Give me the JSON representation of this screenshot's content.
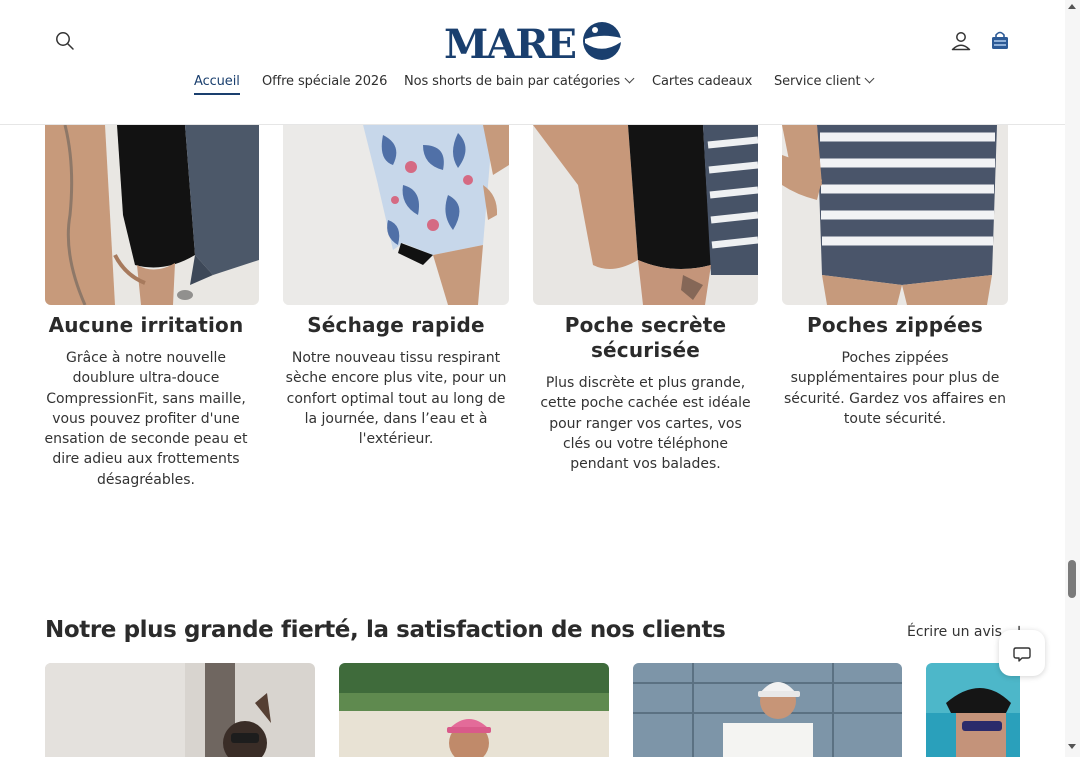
{
  "brand": {
    "logo_text": "MARE",
    "primary_color": "#1a3f6e",
    "accent_color": "#2c5a96"
  },
  "header": {
    "search_icon": "search-icon",
    "account_icon": "account-icon",
    "cart_icon": "shopping-bag-icon",
    "nav": [
      {
        "label": "Accueil",
        "active": true
      },
      {
        "label": "Offre spéciale 2026"
      },
      {
        "label": "Nos shorts de bain par catégories",
        "has_dropdown": true
      },
      {
        "label": "Cartes cadeaux"
      },
      {
        "label": "Service client",
        "has_dropdown": true
      }
    ]
  },
  "features": [
    {
      "title": "Aucune irritation",
      "lines": [
        "Grâce à notre nouvelle",
        "doublure ultra-douce",
        "CompressionFit, sans maille,",
        "vous pouvez profiter d'une",
        "ensation de seconde peau et",
        "dire adieu aux frottements",
        "désagréables."
      ]
    },
    {
      "title": "Séchage rapide",
      "lines": [
        "Notre nouveau tissu respirant",
        "sèche encore plus vite, pour un",
        "confort optimal tout au long de",
        "la journée, dans l’eau et à",
        "l'extérieur."
      ]
    },
    {
      "title_lines": [
        "Poche secrète",
        "sécurisée"
      ],
      "lines": [
        "Plus discrète et plus grande,",
        "cette poche cachée est idéale",
        "pour ranger vos cartes, vos",
        "clés ou votre téléphone",
        "pendant vos balades."
      ]
    },
    {
      "title": "Poches zippées",
      "lines": [
        "Poches zippées",
        "supplémentaires pour plus de",
        "sécurité. Gardez vos affaires en",
        "toute sécurité."
      ]
    }
  ],
  "reviews": {
    "title": "Notre plus grande fierté, la satisfaction de nos clients",
    "write_review": "Écrire un avis",
    "write_review_icon": "plus-icon"
  },
  "chat": {
    "icon": "chat-bubble-icon"
  }
}
